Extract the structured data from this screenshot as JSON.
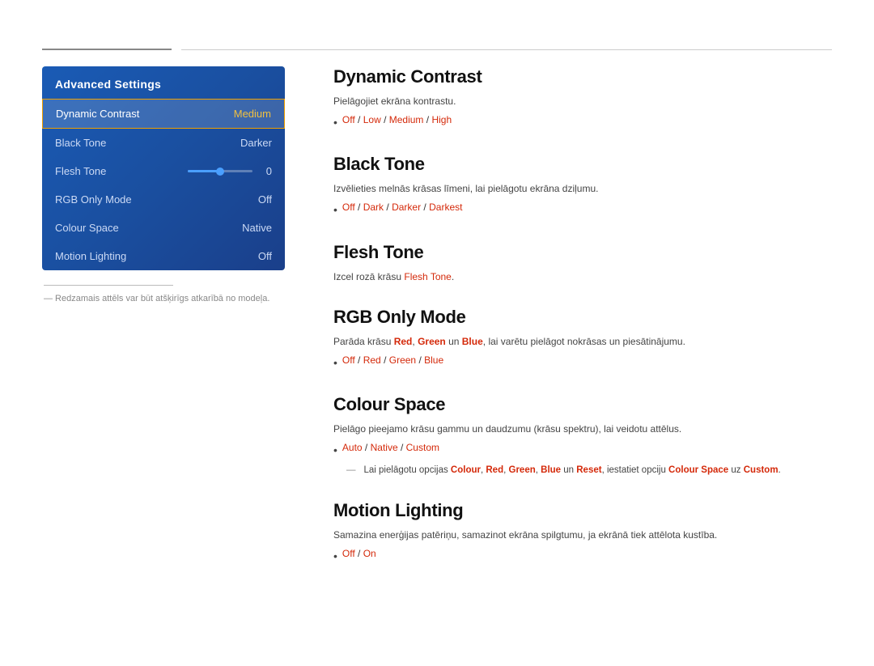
{
  "top_dividers": {
    "short": "",
    "long": ""
  },
  "sidebar": {
    "title": "Advanced Settings",
    "items": [
      {
        "label": "Dynamic Contrast",
        "value": "Medium",
        "active": true
      },
      {
        "label": "Black Tone",
        "value": "Darker",
        "active": false
      },
      {
        "label": "Flesh Tone",
        "value": "slider",
        "sliderValue": "0",
        "active": false
      },
      {
        "label": "RGB Only Mode",
        "value": "Off",
        "active": false
      },
      {
        "label": "Colour Space",
        "value": "Native",
        "active": false
      },
      {
        "label": "Motion Lighting",
        "value": "Off",
        "active": false
      }
    ]
  },
  "note": "— Redzamais attēls var būt atšķirīgs atkarībā no modeļa.",
  "sections": [
    {
      "id": "dynamic-contrast",
      "title": "Dynamic Contrast",
      "desc": "Pielāgojiet ekrāna kontrastu.",
      "bullet": "Off / Low / Medium / High",
      "bulletParts": [
        {
          "text": "Off",
          "highlight": true
        },
        {
          "text": " / ",
          "highlight": false
        },
        {
          "text": "Low",
          "highlight": true
        },
        {
          "text": " / ",
          "highlight": false
        },
        {
          "text": "Medium",
          "highlight": true
        },
        {
          "text": " / ",
          "highlight": false
        },
        {
          "text": "High",
          "highlight": true
        }
      ]
    },
    {
      "id": "black-tone",
      "title": "Black Tone",
      "desc": "Izvēlieties melnās krāsas līmeni, lai pielāgotu ekrāna dziļumu.",
      "bulletParts": [
        {
          "text": "Off",
          "highlight": true
        },
        {
          "text": " / ",
          "highlight": false
        },
        {
          "text": "Dark",
          "highlight": true
        },
        {
          "text": " / ",
          "highlight": false
        },
        {
          "text": "Darker",
          "highlight": true
        },
        {
          "text": " / ",
          "highlight": false
        },
        {
          "text": "Darkest",
          "highlight": true
        }
      ]
    },
    {
      "id": "flesh-tone",
      "title": "Flesh Tone",
      "desc": "Izcel rozā krāsu",
      "descEnd": "Flesh Tone",
      "descEndPunct": ".",
      "bulletParts": []
    },
    {
      "id": "rgb-only-mode",
      "title": "RGB Only Mode",
      "desc": "Parāda krāsu",
      "descRed1": "Red",
      "descMiddle": ",",
      "descRed2": "Green",
      "descMiddle2": "un",
      "descRed3": "Blue",
      "descEnd2": ", lai varētu pielāgot nokrāsas un piesātinājumu.",
      "bulletParts": [
        {
          "text": "Off",
          "highlight": true
        },
        {
          "text": " / ",
          "highlight": false
        },
        {
          "text": "Red",
          "highlight": true
        },
        {
          "text": " / ",
          "highlight": false
        },
        {
          "text": "Green",
          "highlight": true
        },
        {
          "text": " / ",
          "highlight": false
        },
        {
          "text": "Blue",
          "highlight": true
        }
      ]
    },
    {
      "id": "colour-space",
      "title": "Colour Space",
      "desc": "Pielāgo pieejamo krāsu gammu un daudzumu (krāsu spektru), lai veidotu attēlus.",
      "bulletParts": [
        {
          "text": "Auto",
          "highlight": true
        },
        {
          "text": " / ",
          "highlight": false
        },
        {
          "text": "Native",
          "highlight": true
        },
        {
          "text": " / ",
          "highlight": false
        },
        {
          "text": "Custom",
          "highlight": true
        }
      ],
      "indentNote": "Lai pielāgotu opcijas Colour, Red, Green, Blue un Reset, iestatiet opciju Colour Space uz Custom."
    },
    {
      "id": "motion-lighting",
      "title": "Motion Lighting",
      "desc": "Samazina enerģijas patēriņu, samazinot ekrāna spilgtumu, ja ekrānā tiek attēlota kustība.",
      "bulletParts": [
        {
          "text": "Off",
          "highlight": true
        },
        {
          "text": " / ",
          "highlight": false
        },
        {
          "text": "On",
          "highlight": true
        }
      ]
    }
  ]
}
